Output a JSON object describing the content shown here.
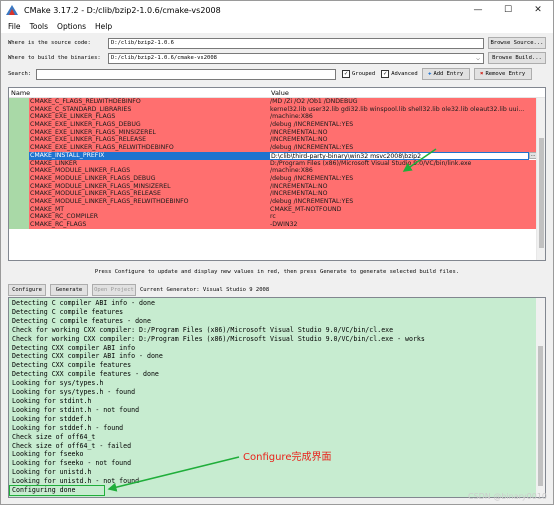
{
  "window": {
    "title": "CMake 3.17.2 - D:/clib/bzip2-1.0.6/cmake-vs2008",
    "minimize": "—",
    "maximize": "☐",
    "close": "✕"
  },
  "menu": [
    "File",
    "Tools",
    "Options",
    "Help"
  ],
  "source": {
    "label": "Where is the source code:",
    "value": "D:/clib/bzip2-1.0.6",
    "browse_label": "Browse Source..."
  },
  "build": {
    "label": "Where to build the binaries:",
    "value": "D:/clib/bzip2-1.0.6/cmake-vs2008",
    "browse_label": "Browse Build..."
  },
  "search": {
    "label": "Search:",
    "value": "",
    "grouped_label": "Grouped",
    "grouped_checked": true,
    "advanced_label": "Advanced",
    "advanced_checked": true,
    "add_entry_label": "Add Entry",
    "remove_entry_label": "Remove Entry"
  },
  "table": {
    "headers": {
      "name": "Name",
      "value": "Value"
    },
    "rows": [
      {
        "name": "CMAKE_C_FLAGS_RELWITHDEBINFO",
        "value": "/MD /Zi /O2 /Ob1 /DNDEBUG"
      },
      {
        "name": "CMAKE_C_STANDARD_LIBRARIES",
        "value": "kernel32.lib user32.lib gdi32.lib winspool.lib shell32.lib ole32.lib oleaut32.lib uui..."
      },
      {
        "name": "CMAKE_EXE_LINKER_FLAGS",
        "value": "/machine:X86"
      },
      {
        "name": "CMAKE_EXE_LINKER_FLAGS_DEBUG",
        "value": "/debug /INCREMENTAL:YES"
      },
      {
        "name": "CMAKE_EXE_LINKER_FLAGS_MINSIZEREL",
        "value": "/INCREMENTAL:NO"
      },
      {
        "name": "CMAKE_EXE_LINKER_FLAGS_RELEASE",
        "value": "/INCREMENTAL:NO"
      },
      {
        "name": "CMAKE_EXE_LINKER_FLAGS_RELWITHDEBINFO",
        "value": "/debug /INCREMENTAL:YES"
      },
      {
        "name": "CMAKE_INSTALL_PREFIX",
        "value": "D:\\clib\\third-party-binary\\win32 msvc2008\\bzip2",
        "selected": true,
        "edit_button": "..."
      },
      {
        "name": "CMAKE_LINKER",
        "value": "D:/Program Files (x86)/Microsoft Visual Studio 9.0/VC/bin/link.exe"
      },
      {
        "name": "CMAKE_MODULE_LINKER_FLAGS",
        "value": "/machine:X86"
      },
      {
        "name": "CMAKE_MODULE_LINKER_FLAGS_DEBUG",
        "value": "/debug /INCREMENTAL:YES"
      },
      {
        "name": "CMAKE_MODULE_LINKER_FLAGS_MINSIZEREL",
        "value": "/INCREMENTAL:NO"
      },
      {
        "name": "CMAKE_MODULE_LINKER_FLAGS_RELEASE",
        "value": "/INCREMENTAL:NO"
      },
      {
        "name": "CMAKE_MODULE_LINKER_FLAGS_RELWITHDEBINFO",
        "value": "/debug /INCREMENTAL:YES"
      },
      {
        "name": "CMAKE_MT",
        "value": "CMAKE_MT-NOTFOUND"
      },
      {
        "name": "CMAKE_RC_COMPILER",
        "value": "rc"
      },
      {
        "name": "CMAKE_RC_FLAGS",
        "value": "-DWIN32"
      }
    ]
  },
  "status_message": "Press Configure to update and display new values in red, then press Generate to generate selected build files.",
  "actions": {
    "configure_label": "Configure",
    "generate_label": "Generate",
    "open_project_label": "Open Project",
    "current_generator": "Current Generator: Visual Studio 9 2008"
  },
  "output_lines": [
    "Detecting C compiler ABI info - done",
    "Detecting C compile features",
    "Detecting C compile features - done",
    "Check for working CXX compiler: D:/Program Files (x86)/Microsoft Visual Studio 9.0/VC/bin/cl.exe",
    "Check for working CXX compiler: D:/Program Files (x86)/Microsoft Visual Studio 9.0/VC/bin/cl.exe - works",
    "Detecting CXX compiler ABI info",
    "Detecting CXX compiler ABI info - done",
    "Detecting CXX compile features",
    "Detecting CXX compile features - done",
    "Looking for sys/types.h",
    "Looking for sys/types.h - found",
    "Looking for stdint.h",
    "Looking for stdint.h - not found",
    "Looking for stddef.h",
    "Looking for stddef.h - found",
    "Check size of off64_t",
    "Check size of off64_t - failed",
    "Looking for fseeko",
    "Looking for fseeko - not found",
    "Looking for unistd.h",
    "Looking for unistd.h - not found",
    "Configuring done"
  ],
  "annotation": "Configure完成界面",
  "watermark": "CSDN @binary0010",
  "colors": {
    "new_entry_red": "#ff6f6f",
    "output_green": "#c7ecd0",
    "selection_blue": "#1e73cf",
    "annotation_red": "#e8221a",
    "arrow_green": "#1fae3a"
  }
}
